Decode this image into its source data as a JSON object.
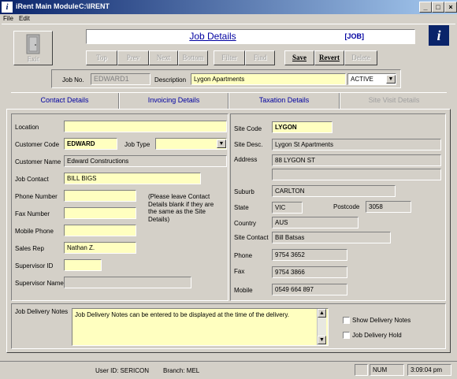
{
  "window": {
    "title": "iRent Main Module",
    "path": "C:\\IRENT",
    "min_glyph": "_",
    "max_glyph": "□",
    "close_glyph": "×"
  },
  "menu": {
    "file": "File",
    "edit": "Edit"
  },
  "header": {
    "title": "Job Details",
    "code": "[JOB]",
    "exit_label": "Exit"
  },
  "toolbar": {
    "top": "Top",
    "prev": "Prev",
    "next": "Next",
    "bottom": "Bottom",
    "filter": "Filter",
    "find": "Find",
    "save": "Save",
    "revert": "Revert",
    "delete": "Delete"
  },
  "job": {
    "job_no_label": "Job No.",
    "job_no": "EDWARD1",
    "description_label": "Description",
    "description": "Lygon Apartments",
    "status": "ACTIVE"
  },
  "tabs": {
    "contact": "Contact Details",
    "invoicing": "Invoicing Details",
    "taxation": "Taxation Details",
    "site_visit": "Site Visit Details"
  },
  "contact": {
    "location_label": "Location",
    "location": "",
    "customer_code_label": "Customer Code",
    "customer_code": "EDWARD",
    "job_type_label": "Job Type",
    "job_type": "",
    "customer_name_label": "Customer Name",
    "customer_name": "Edward Constructions",
    "job_contact_label": "Job Contact",
    "job_contact": "BILL BIGS",
    "phone_label": "Phone Number",
    "phone": "",
    "fax_label": "Fax Number",
    "fax": "",
    "mobile_label": "Mobile Phone",
    "mobile": "",
    "note": "(Please leave Contact Details blank if they are the same as the Site Details)",
    "sales_rep_label": "Sales Rep",
    "sales_rep": "Nathan Z.",
    "supervisor_id_label": "Supervisor ID",
    "supervisor_id": "",
    "supervisor_name_label": "Supervisor Name",
    "supervisor_name": ""
  },
  "site": {
    "code_label": "Site Code",
    "code": "LYGON",
    "desc_label": "Site Desc.",
    "desc": "Lygon St Apartments",
    "address_label": "Address",
    "address1": "88 LYGON ST",
    "address2": "",
    "suburb_label": "Suburb",
    "suburb": "CARLTON",
    "state_label": "State",
    "state": "VIC",
    "postcode_label": "Postcode",
    "postcode": "3058",
    "country_label": "Country",
    "country": "AUS",
    "contact_label": "Site Contact",
    "contact": "Bill Batsas",
    "phone_label": "Phone",
    "phone": "9754 3652",
    "fax_label": "Fax",
    "fax": "9754 3866",
    "mobile_label": "Mobile",
    "mobile": "0549 664 897"
  },
  "delivery": {
    "label": "Job Delivery Notes",
    "notes": "Job Delivery Notes can be entered to be displayed at the time of the delivery.",
    "show_label": "Show Delivery Notes",
    "hold_label": "Job Delivery Hold"
  },
  "status": {
    "user": "User ID: SERICON",
    "branch": "Branch: MEL",
    "num": "NUM",
    "time": "3:09:04 pm"
  },
  "logo_text": "iRent"
}
